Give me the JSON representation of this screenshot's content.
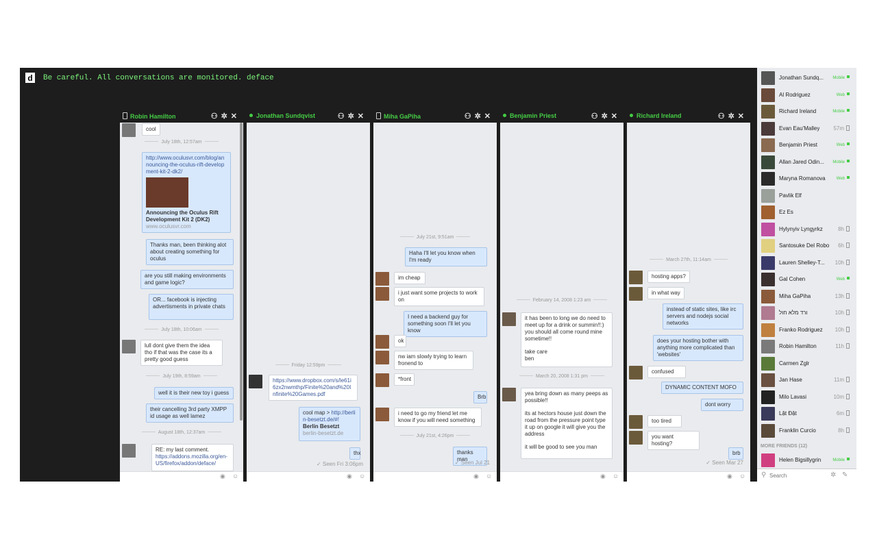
{
  "banner": "Be careful. All conversations are monitored. deface",
  "logo_letter": "d",
  "chats": [
    {
      "name": "Robin Hamilton",
      "device": "mobile",
      "messages": [
        {
          "text": "cool"
        },
        {
          "ts": "July 18th, 12:57am"
        },
        {
          "link": "http://www.oculusvr.com/blog/announcing-the-oculus-rift-development-kit-2-dk2/",
          "title": "Announcing the Oculus Rift Development Kit 2 (DK2)",
          "domain": "www.oculusvr.com"
        },
        {
          "text": "Thanks man, been thinking alot about creating something for oculus"
        },
        {
          "text": "are you still making environments and game logic?"
        },
        {
          "text": "OR... facebook is injecting advertisments in private chats"
        },
        {
          "ts": "July 18th, 10:06am"
        },
        {
          "text": "lull dont give them the idea tho if that was the case its a pretty good guess"
        },
        {
          "ts": "July 19th, 8:59am"
        },
        {
          "text": "well it is their new toy i guess"
        },
        {
          "text": "their cancelling 3rd party XMPP id usage as well lamez"
        },
        {
          "ts": "August 18th, 12:37am"
        },
        {
          "text": "RE: my last comment.",
          "link": "https://addons.mozilla.org/en-US/firefox/addon/deface/"
        }
      ]
    },
    {
      "name": "Jonathan Sundqvist",
      "device": "web",
      "messages": [
        {
          "ts": "Friday 12:59pm"
        },
        {
          "link": "https://www.dropbox.com/s/le61i6zx2nwmthp/Finite%20and%20Infinite%20Games.pdf"
        },
        {
          "text": "cool map > ",
          "link": "http://berlin-besetzt.de/#!",
          "title": "Berlin Besetzt",
          "domain": "berlin-besetzt.de"
        },
        {
          "text": "thx"
        },
        {
          "seen": "Seen Fri 3:06pm"
        }
      ]
    },
    {
      "name": "Miha GaPiha",
      "device": "mobile",
      "messages": [
        {
          "ts": "July 21st, 9:51am"
        },
        {
          "text": "Haha I'll let you know when I'm ready"
        },
        {
          "text": "im cheap"
        },
        {
          "text": "i just want some projects to work on"
        },
        {
          "text": "I need a backend guy for something soon I'll let you know"
        },
        {
          "text": "ok"
        },
        {
          "text": "nw iam slowly trying to learn fronend to"
        },
        {
          "text": "*front"
        },
        {
          "text": "Brb"
        },
        {
          "text": "i need to go my friend let me know if you will need something"
        },
        {
          "ts": "July 21st, 4:26pm"
        },
        {
          "text": "thanks man"
        },
        {
          "seen": "Seen Jul 21"
        }
      ]
    },
    {
      "name": "Benjamin Priest",
      "device": "web",
      "messages": [
        {
          "ts": "February 14, 2008 1:23 am"
        },
        {
          "text": "it has been to long we do need to meet up for a drink or summin!!:) you should all come round mine sometime!!",
          "text2": "take care",
          "text3": "ben"
        },
        {
          "ts": "March 20, 2008 1:31 pm"
        },
        {
          "text": "yea bring down as many peeps as possible!!",
          "text2": "its at hectors house just down the road from the pressure point type it up on google it will give you the address",
          "text3": "it will be good to see you man"
        }
      ]
    },
    {
      "name": "Richard Ireland",
      "device": "web",
      "messages": [
        {
          "ts": "March 27th, 11:14am"
        },
        {
          "text": "hosting apps?"
        },
        {
          "text": "in what way"
        },
        {
          "text": "instead of static sites, like irc servers and nodejs social networks"
        },
        {
          "text": "does your hosting bother with anything more complicated than 'websites'"
        },
        {
          "text": "confused"
        },
        {
          "text": "DYNAMIC CONTENT MOFO"
        },
        {
          "text": "dont worry"
        },
        {
          "text": "too tired"
        },
        {
          "text": "you want hosting?"
        },
        {
          "text": "brb"
        },
        {
          "seen": "Seen Mar 27"
        }
      ]
    }
  ],
  "buddies": [
    {
      "name": "Jonathan Sundq...",
      "status": "Mobile",
      "color": "#555"
    },
    {
      "name": "Al Rodriguez",
      "status": "Web",
      "color": "#6a4a3a"
    },
    {
      "name": "Richard Ireland",
      "status": "Mobile",
      "color": "#6b5a3a"
    },
    {
      "name": "Evan Eau'Malley",
      "status": "57m",
      "color": "#4a3a3a"
    },
    {
      "name": "Benjamin Priest",
      "status": "Web",
      "color": "#8a6a50"
    },
    {
      "name": "Allan Jared Odin...",
      "status": "Mobile",
      "color": "#3a4a3a"
    },
    {
      "name": "Maryna Romanova",
      "status": "Web",
      "color": "#2a2a2a"
    },
    {
      "name": "Pavlik Elf",
      "status": "",
      "color": "#9aa09a"
    },
    {
      "name": "Ez Es",
      "status": "",
      "color": "#a06030"
    },
    {
      "name": "Hylynyiv Lyngyrkz",
      "status": "8h",
      "color": "#c050a0"
    },
    {
      "name": "Santosuke Del Robo",
      "status": "6h",
      "color": "#e0d080"
    },
    {
      "name": "Lauren Shelley-T...",
      "status": "10h",
      "color": "#3a3a6a"
    },
    {
      "name": "Gal Cohen",
      "status": "Web",
      "color": "#3a3030"
    },
    {
      "name": "Miha GaPiha",
      "status": "13h",
      "color": "#8a5a3a"
    },
    {
      "name": "ורד מלא חול",
      "status": "10h",
      "color": "#b07a90"
    },
    {
      "name": "Franko Rodriguez",
      "status": "10h",
      "color": "#c08040"
    },
    {
      "name": "Robin Hamilton",
      "status": "11h",
      "color": "#7a7a7a"
    },
    {
      "name": "Carmen Zglr",
      "status": "",
      "color": "#5a7a3a"
    },
    {
      "name": "Jan Hase",
      "status": "11m",
      "color": "#6a5040"
    },
    {
      "name": "Milo Lavasi",
      "status": "10m",
      "color": "#222"
    },
    {
      "name": "Lật Đật",
      "status": "6m",
      "color": "#3a3a5a"
    },
    {
      "name": "Franklin Curcio",
      "status": "8h",
      "color": "#5a4a3a"
    }
  ],
  "more_friends": "MORE FRIENDS (12)",
  "helen": {
    "name": "Helen Bigsillygrin",
    "status": "Mobile",
    "color": "#d04080"
  },
  "search_placeholder": "Search"
}
